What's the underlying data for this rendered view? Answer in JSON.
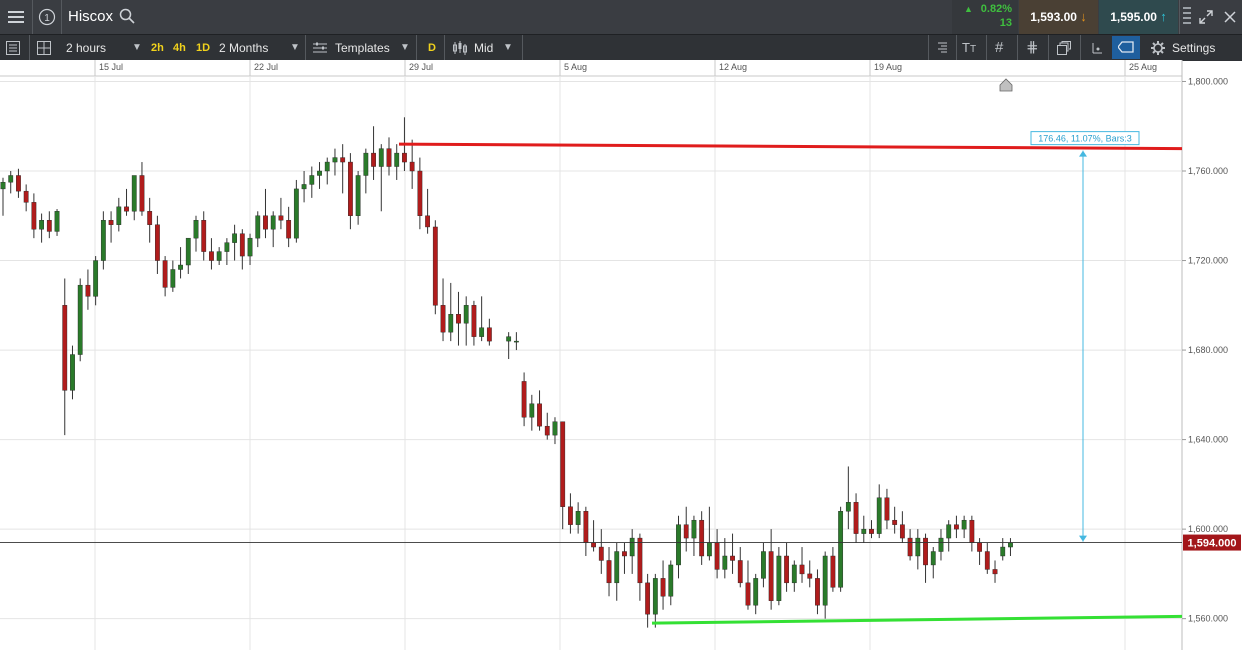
{
  "header": {
    "menu_icon": "hamburger-menu-icon",
    "info_icon": "info-circle-icon",
    "instrument": "Hiscox",
    "search_icon": "search-icon",
    "change_pct": "0.82%",
    "change_pts": "13",
    "sell_price": "1,593.00",
    "buy_price": "1,595.00",
    "colors": {
      "up": "#3fbf3f",
      "sell_bg": "#4a4034",
      "buy_bg": "#2f4a4e",
      "sell_arrow": "#e0901c",
      "buy_arrow": "#2ec2d6"
    }
  },
  "toolbar": {
    "interval": "2 hours",
    "quick_intervals": [
      "2h",
      "4h",
      "1D"
    ],
    "range": "2 Months",
    "templates_label": "Templates",
    "d_label": "D",
    "price_mode": "Mid",
    "settings_label": "Settings"
  },
  "chart_data": {
    "type": "candlestick",
    "x_tick_labels": [
      "15 Jul",
      "22 Jul",
      "29 Jul",
      "5 Aug",
      "12 Aug",
      "19 Aug",
      "25 Aug"
    ],
    "y_tick_labels": [
      "1,800.000",
      "1,760.000",
      "1,720.000",
      "1,680.000",
      "1,640.000",
      "1,600.000",
      "1,560.000"
    ],
    "ylim": [
      1546,
      1802
    ],
    "current_price_label": "1,594.000",
    "current_price": 1594,
    "measure_label": "176.46, 11.07%, Bars:3",
    "resistance": {
      "start": 1772,
      "end": 1770,
      "color": "#e01c1c"
    },
    "support": {
      "start": 1558,
      "end": 1561,
      "color": "#34e034"
    },
    "up_color": "#2a7a2a",
    "down_color": "#b01c1c",
    "candles": [
      [
        1752,
        1757,
        1740,
        1755
      ],
      [
        1755,
        1760,
        1750,
        1758
      ],
      [
        1758,
        1761,
        1748,
        1751
      ],
      [
        1751,
        1754,
        1742,
        1746
      ],
      [
        1746,
        1750,
        1730,
        1734
      ],
      [
        1734,
        1741,
        1728,
        1738
      ],
      [
        1738,
        1742,
        1730,
        1733
      ],
      [
        1733,
        1743,
        1731,
        1742
      ],
      [
        1700,
        1712,
        1642,
        1662
      ],
      [
        1662,
        1682,
        1658,
        1678
      ],
      [
        1678,
        1712,
        1675,
        1709
      ],
      [
        1709,
        1716,
        1698,
        1704
      ],
      [
        1704,
        1722,
        1700,
        1720
      ],
      [
        1720,
        1742,
        1716,
        1738
      ],
      [
        1738,
        1742,
        1728,
        1736
      ],
      [
        1736,
        1748,
        1733,
        1744
      ],
      [
        1744,
        1752,
        1740,
        1742
      ],
      [
        1742,
        1758,
        1738,
        1758
      ],
      [
        1758,
        1764,
        1740,
        1742
      ],
      [
        1742,
        1748,
        1728,
        1736
      ],
      [
        1736,
        1740,
        1714,
        1720
      ],
      [
        1720,
        1722,
        1704,
        1708
      ],
      [
        1708,
        1720,
        1706,
        1716
      ],
      [
        1716,
        1726,
        1712,
        1718
      ],
      [
        1718,
        1730,
        1714,
        1730
      ],
      [
        1730,
        1740,
        1724,
        1738
      ],
      [
        1738,
        1742,
        1720,
        1724
      ],
      [
        1724,
        1730,
        1716,
        1720
      ],
      [
        1720,
        1726,
        1718,
        1724
      ],
      [
        1724,
        1730,
        1718,
        1728
      ],
      [
        1728,
        1736,
        1720,
        1732
      ],
      [
        1732,
        1734,
        1716,
        1722
      ],
      [
        1722,
        1732,
        1718,
        1730
      ],
      [
        1730,
        1742,
        1726,
        1740
      ],
      [
        1740,
        1752,
        1730,
        1734
      ],
      [
        1734,
        1742,
        1726,
        1740
      ],
      [
        1740,
        1748,
        1734,
        1738
      ],
      [
        1738,
        1744,
        1726,
        1730
      ],
      [
        1730,
        1756,
        1728,
        1752
      ],
      [
        1752,
        1760,
        1746,
        1754
      ],
      [
        1754,
        1762,
        1748,
        1758
      ],
      [
        1758,
        1764,
        1752,
        1760
      ],
      [
        1760,
        1766,
        1754,
        1764
      ],
      [
        1764,
        1770,
        1758,
        1766
      ],
      [
        1766,
        1772,
        1750,
        1764
      ],
      [
        1764,
        1768,
        1734,
        1740
      ],
      [
        1740,
        1760,
        1736,
        1758
      ],
      [
        1758,
        1770,
        1750,
        1768
      ],
      [
        1768,
        1780,
        1756,
        1762
      ],
      [
        1762,
        1772,
        1742,
        1770
      ],
      [
        1770,
        1775,
        1758,
        1762
      ],
      [
        1762,
        1772,
        1756,
        1768
      ],
      [
        1768,
        1784,
        1760,
        1764
      ],
      [
        1764,
        1774,
        1752,
        1760
      ],
      [
        1760,
        1766,
        1734,
        1740
      ],
      [
        1740,
        1752,
        1732,
        1735
      ],
      [
        1735,
        1738,
        1696,
        1700
      ],
      [
        1700,
        1712,
        1684,
        1688
      ],
      [
        1688,
        1710,
        1684,
        1696
      ],
      [
        1696,
        1706,
        1682,
        1692
      ],
      [
        1692,
        1704,
        1682,
        1700
      ],
      [
        1700,
        1702,
        1682,
        1686
      ],
      [
        1686,
        1704,
        1684,
        1690
      ],
      [
        1690,
        1694,
        1682,
        1684
      ],
      [
        1684,
        1688,
        1676,
        1686
      ],
      [
        1684,
        1688,
        1680,
        1684
      ],
      [
        1666,
        1670,
        1646,
        1650
      ],
      [
        1650,
        1660,
        1644,
        1656
      ],
      [
        1656,
        1662,
        1644,
        1646
      ],
      [
        1646,
        1652,
        1640,
        1642
      ],
      [
        1642,
        1650,
        1638,
        1648
      ],
      [
        1648,
        1648,
        1600,
        1610
      ],
      [
        1610,
        1616,
        1598,
        1602
      ],
      [
        1602,
        1612,
        1598,
        1608
      ],
      [
        1608,
        1610,
        1588,
        1594
      ],
      [
        1594,
        1604,
        1590,
        1592
      ],
      [
        1592,
        1600,
        1580,
        1586
      ],
      [
        1586,
        1592,
        1570,
        1576
      ],
      [
        1576,
        1594,
        1568,
        1590
      ],
      [
        1590,
        1594,
        1580,
        1588
      ],
      [
        1588,
        1600,
        1580,
        1596
      ],
      [
        1596,
        1598,
        1568,
        1576
      ],
      [
        1576,
        1580,
        1556,
        1562
      ],
      [
        1562,
        1580,
        1556,
        1578
      ],
      [
        1578,
        1586,
        1564,
        1570
      ],
      [
        1570,
        1586,
        1566,
        1584
      ],
      [
        1584,
        1606,
        1578,
        1602
      ],
      [
        1602,
        1610,
        1590,
        1596
      ],
      [
        1596,
        1606,
        1588,
        1604
      ],
      [
        1604,
        1608,
        1584,
        1588
      ],
      [
        1588,
        1610,
        1586,
        1594
      ],
      [
        1594,
        1600,
        1578,
        1582
      ],
      [
        1582,
        1596,
        1578,
        1588
      ],
      [
        1588,
        1598,
        1580,
        1586
      ],
      [
        1586,
        1592,
        1574,
        1576
      ],
      [
        1576,
        1586,
        1564,
        1566
      ],
      [
        1566,
        1580,
        1562,
        1578
      ],
      [
        1578,
        1594,
        1574,
        1590
      ],
      [
        1590,
        1600,
        1564,
        1568
      ],
      [
        1568,
        1592,
        1566,
        1588
      ],
      [
        1588,
        1594,
        1572,
        1576
      ],
      [
        1576,
        1586,
        1572,
        1584
      ],
      [
        1584,
        1592,
        1576,
        1580
      ],
      [
        1580,
        1586,
        1574,
        1578
      ],
      [
        1578,
        1582,
        1562,
        1566
      ],
      [
        1566,
        1590,
        1560,
        1588
      ],
      [
        1588,
        1592,
        1572,
        1574
      ],
      [
        1574,
        1610,
        1572,
        1608
      ],
      [
        1608,
        1628,
        1600,
        1612
      ],
      [
        1612,
        1616,
        1594,
        1598
      ],
      [
        1598,
        1606,
        1594,
        1600
      ],
      [
        1600,
        1604,
        1596,
        1598
      ],
      [
        1598,
        1620,
        1596,
        1614
      ],
      [
        1614,
        1618,
        1600,
        1604
      ],
      [
        1604,
        1610,
        1598,
        1602
      ],
      [
        1602,
        1608,
        1594,
        1596
      ],
      [
        1596,
        1600,
        1586,
        1588
      ],
      [
        1588,
        1600,
        1582,
        1596
      ],
      [
        1596,
        1598,
        1576,
        1584
      ],
      [
        1584,
        1592,
        1578,
        1590
      ],
      [
        1590,
        1600,
        1586,
        1596
      ],
      [
        1596,
        1604,
        1590,
        1602
      ],
      [
        1602,
        1606,
        1596,
        1600
      ],
      [
        1600,
        1606,
        1596,
        1604
      ],
      [
        1604,
        1606,
        1590,
        1594
      ],
      [
        1594,
        1596,
        1584,
        1590
      ],
      [
        1590,
        1594,
        1580,
        1582
      ],
      [
        1582,
        1586,
        1576,
        1580
      ],
      [
        1588,
        1596,
        1586,
        1592
      ],
      [
        1592,
        1596,
        1588,
        1594
      ]
    ]
  }
}
